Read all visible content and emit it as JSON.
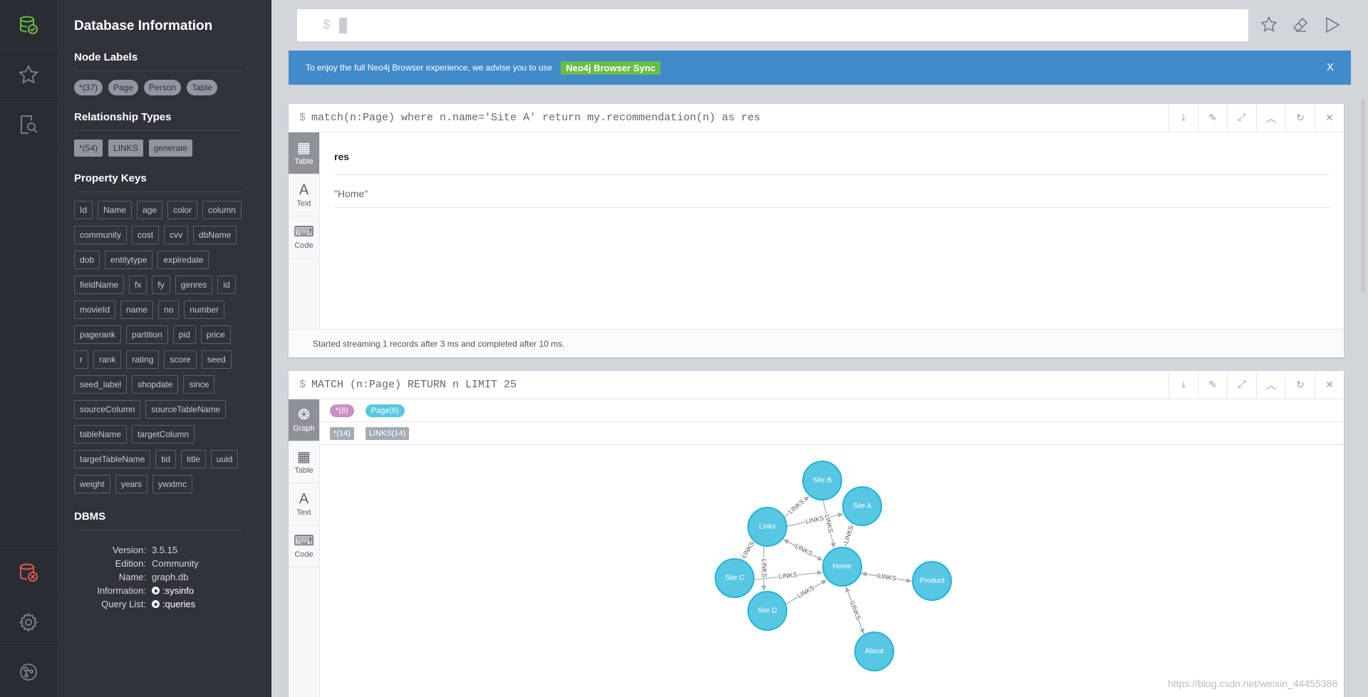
{
  "drawer": {
    "title": "Database Information",
    "node_labels_heading": "Node Labels",
    "node_labels": [
      "*(37)",
      "Page",
      "Person",
      "Table"
    ],
    "rel_types_heading": "Relationship Types",
    "rel_types": [
      "*(54)",
      "LINKS",
      "generate"
    ],
    "property_keys_heading": "Property Keys",
    "property_keys": [
      "Id",
      "Name",
      "age",
      "color",
      "column",
      "community",
      "cost",
      "cvv",
      "dbName",
      "dob",
      "entitytype",
      "expiredate",
      "fieldName",
      "fx",
      "fy",
      "genres",
      "id",
      "movieId",
      "name",
      "no",
      "number",
      "pagerank",
      "partition",
      "pid",
      "price",
      "r",
      "rank",
      "rating",
      "score",
      "seed",
      "seed_label",
      "shopdate",
      "since",
      "sourceColumn",
      "sourceTableName",
      "tableName",
      "targetColumn",
      "targetTableName",
      "tid",
      "title",
      "uuid",
      "weight",
      "years",
      "ywxtmc"
    ],
    "dbms_heading": "DBMS",
    "dbms": {
      "version_label": "Version:",
      "version": "3.5.15",
      "edition_label": "Edition:",
      "edition": "Community",
      "name_label": "Name:",
      "name": "graph.db",
      "information_label": "Information:",
      "information": ":sysinfo",
      "querylist_label": "Query List:",
      "querylist": ":queries"
    }
  },
  "editor": {
    "prompt": "$"
  },
  "banner": {
    "text": "To enjoy the full Neo4j Browser experience, we advise you to use",
    "link": "Neo4j Browser Sync",
    "close": "X"
  },
  "frame1": {
    "prompt": "$",
    "query": "match(n:Page) where n.name='Site A' return my.recommendation(n) as res",
    "tabs": {
      "table": "Table",
      "text": "Text",
      "code": "Code"
    },
    "column": "res",
    "value": "\"Home\"",
    "status": "Started streaming 1 records after 3 ms and completed after 10 ms."
  },
  "frame2": {
    "prompt": "$",
    "query": "MATCH (n:Page) RETURN n LIMIT 25",
    "tabs": {
      "graph": "Graph",
      "table": "Table",
      "text": "Text",
      "code": "Code"
    },
    "node_legend": [
      {
        "label": "*(8)",
        "color": "#c990c0"
      },
      {
        "label": "Page(8)",
        "color": "#57c7e3"
      }
    ],
    "rel_legend": [
      "*(14)",
      "LINKS(14)"
    ],
    "nodes": [
      {
        "id": "siteB",
        "label": "Site B"
      },
      {
        "id": "siteA",
        "label": "Site A"
      },
      {
        "id": "links",
        "label": "Links"
      },
      {
        "id": "home",
        "label": "Home"
      },
      {
        "id": "product",
        "label": "Product"
      },
      {
        "id": "siteC",
        "label": "Site C"
      },
      {
        "id": "siteD",
        "label": "Site D"
      },
      {
        "id": "about",
        "label": "About"
      }
    ],
    "edges": [
      {
        "from": "links",
        "to": "siteB",
        "label": "LINKS"
      },
      {
        "from": "links",
        "to": "siteA",
        "label": "LINKS"
      },
      {
        "from": "siteB",
        "to": "home",
        "label": "LINKS"
      },
      {
        "from": "siteA",
        "to": "home",
        "label": "LINKS"
      },
      {
        "from": "links",
        "to": "home",
        "label": "LINKS"
      },
      {
        "from": "home",
        "to": "links",
        "label": "LINKS"
      },
      {
        "from": "links",
        "to": "siteC",
        "label": "LINKS"
      },
      {
        "from": "links",
        "to": "siteD",
        "label": "LINKS"
      },
      {
        "from": "siteC",
        "to": "home",
        "label": "LINKS"
      },
      {
        "from": "siteD",
        "to": "home",
        "label": "LINKS"
      },
      {
        "from": "home",
        "to": "product",
        "label": "LINKS"
      },
      {
        "from": "product",
        "to": "home",
        "label": "LINKS"
      },
      {
        "from": "home",
        "to": "about",
        "label": "LINKS"
      },
      {
        "from": "about",
        "to": "home",
        "label": "LINKS"
      }
    ],
    "node_color": "#57c7e3"
  },
  "watermark": "https://blog.csdn.net/weixin_44455388"
}
